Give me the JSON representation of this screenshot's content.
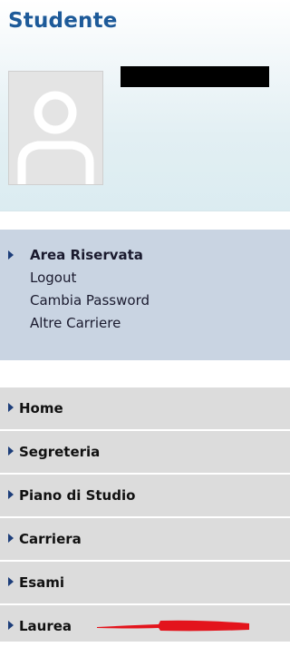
{
  "profile": {
    "title": "Studente",
    "avatar_icon": "user-silhouette-icon"
  },
  "area_menu": {
    "header": "Area Riservata",
    "items": [
      {
        "label": "Logout"
      },
      {
        "label": "Cambia Password"
      },
      {
        "label": "Altre Carriere"
      }
    ]
  },
  "nav_menu": {
    "items": [
      {
        "label": "Home"
      },
      {
        "label": "Segreteria"
      },
      {
        "label": "Piano di Studio"
      },
      {
        "label": "Carriera"
      },
      {
        "label": "Esami"
      },
      {
        "label": "Laurea"
      }
    ]
  },
  "colors": {
    "title": "#1d5a99",
    "area_menu_bg": "#c9d4e2",
    "nav_menu_bg": "#dcdcdc",
    "annotation_red": "#e3141c"
  }
}
